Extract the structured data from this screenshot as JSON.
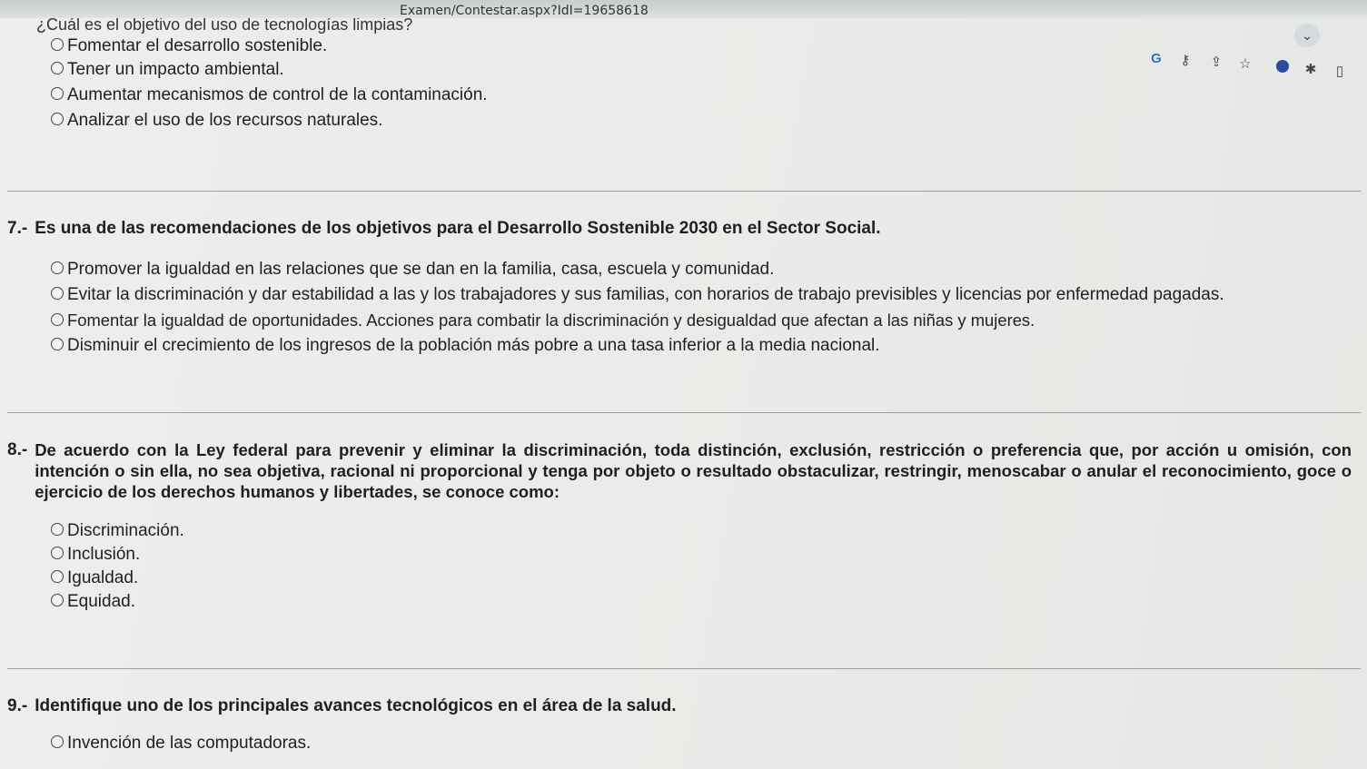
{
  "browser": {
    "url": "Examen/Contestar.aspx?IdI=19658618"
  },
  "q6": {
    "text": "¿Cuál es el objetivo del uso de tecnologías limpias?",
    "options": [
      "Fomentar el desarrollo sostenible.",
      "Tener un impacto ambiental.",
      "Aumentar mecanismos de control de la contaminación.",
      "Analizar el uso de los recursos naturales."
    ]
  },
  "q7": {
    "number": "7.-",
    "text": "Es una de las recomendaciones de los objetivos para el Desarrollo Sostenible 2030 en el Sector Social.",
    "options": [
      "Promover la igualdad en las relaciones que se dan en la familia, casa, escuela y comunidad.",
      "Evitar la discriminación y dar estabilidad a las y los trabajadores y sus familias, con horarios de trabajo previsibles y licencias por enfermedad pagadas.",
      "Fomentar la igualdad de oportunidades. Acciones para combatir la discriminación y desigualdad que afectan a las niñas y mujeres.",
      "Disminuir el crecimiento de los ingresos de la población más pobre a una tasa inferior a la media nacional."
    ]
  },
  "q8": {
    "number": "8.-",
    "text": "De acuerdo con la Ley federal para prevenir y eliminar la discriminación, toda distinción, exclusión, restricción o preferencia que, por acción u omisión, con intención o sin ella, no sea objetiva, racional ni proporcional y tenga por objeto o resultado obstaculizar, restringir, menoscabar o anular el reconocimiento, goce o ejercicio de los derechos humanos y libertades, se conoce como:",
    "options": [
      "Discriminación.",
      "Inclusión.",
      "Igualdad.",
      "Equidad."
    ]
  },
  "q9": {
    "number": "9.-",
    "text": "Identifique uno de los principales avances tecnológicos en el área de la salud.",
    "options": [
      "Invención de las computadoras."
    ]
  }
}
